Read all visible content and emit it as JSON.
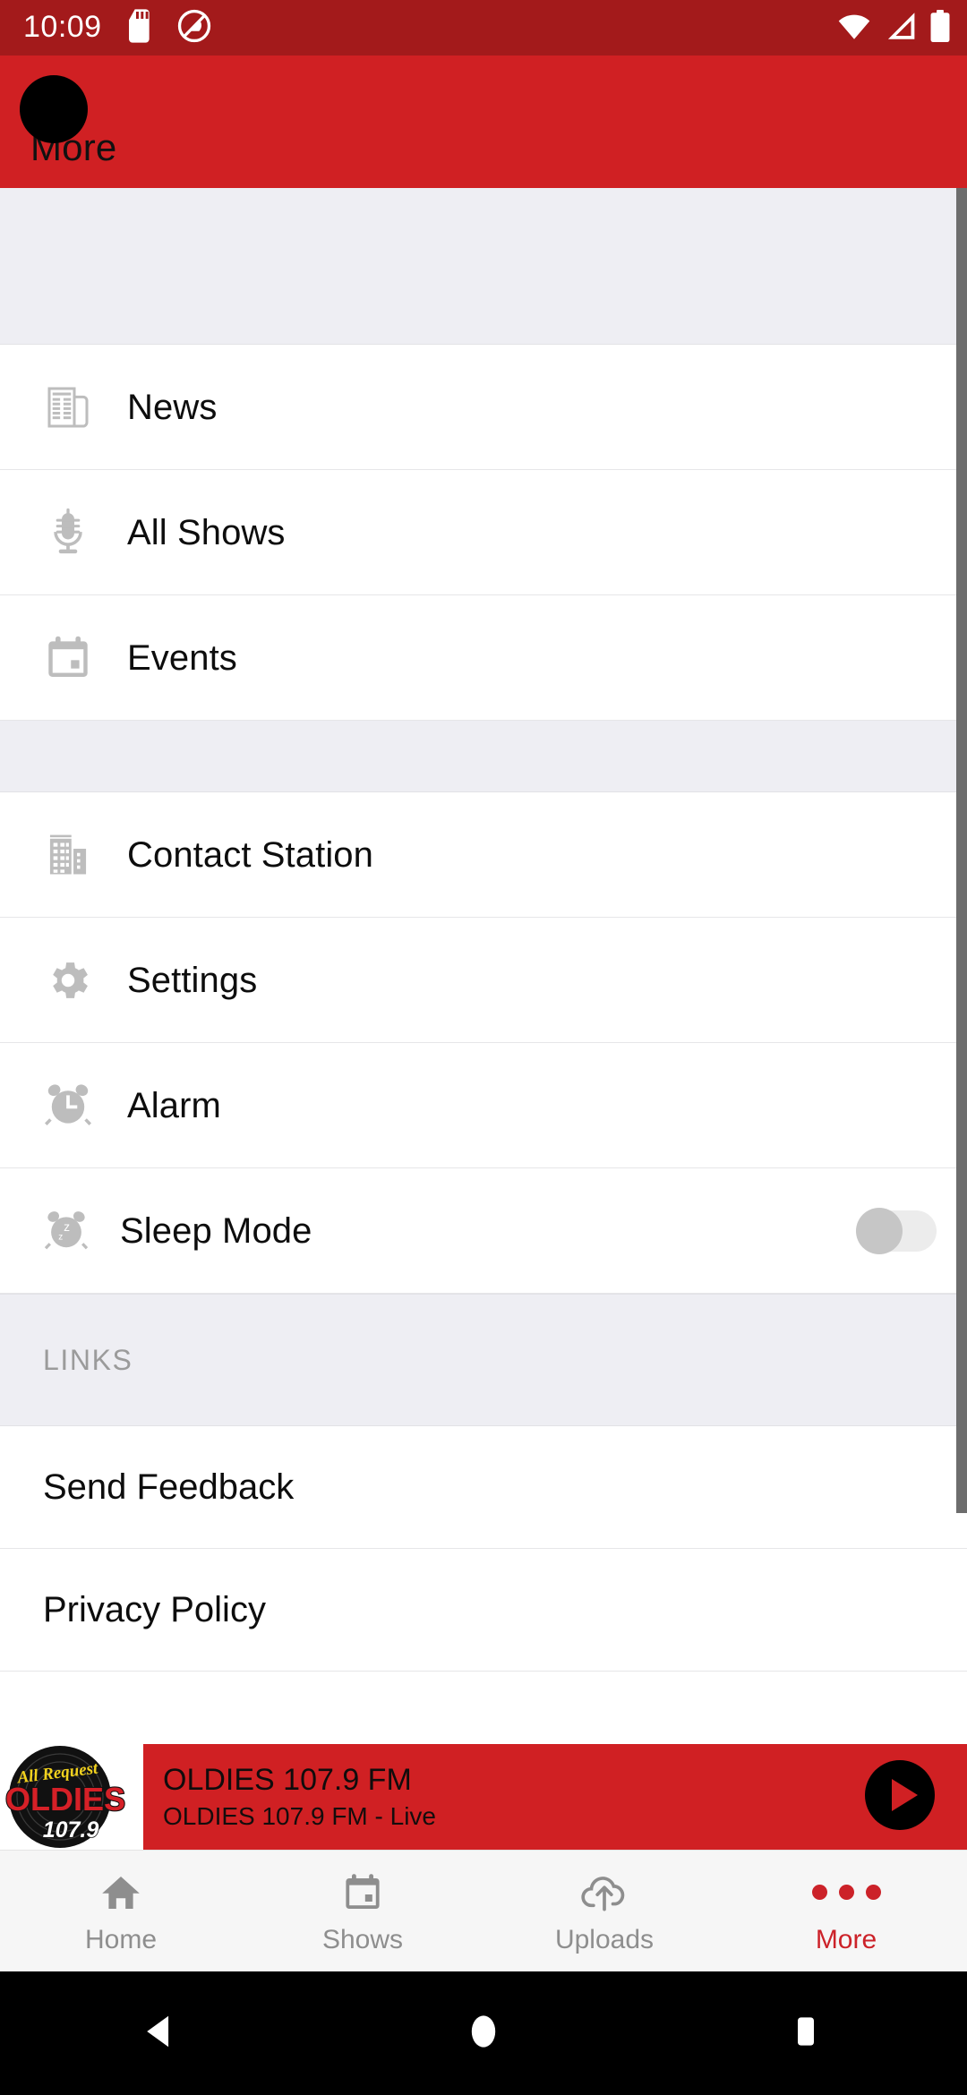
{
  "status_bar": {
    "time": "10:09",
    "left_icons": [
      "sd-card-icon",
      "do-not-disturb-icon"
    ],
    "right_icons": [
      "wifi-icon",
      "cellular-signal-icon",
      "battery-icon"
    ],
    "background_color": "#a31a1b"
  },
  "app_bar": {
    "title": "More",
    "background_color": "#d02023",
    "title_color": "#111111"
  },
  "menu": {
    "group_one": [
      {
        "label": "News",
        "icon": "newspaper-icon"
      },
      {
        "label": "All Shows",
        "icon": "microphone-icon"
      },
      {
        "label": "Events",
        "icon": "calendar-icon"
      }
    ],
    "group_two": [
      {
        "label": "Contact Station",
        "icon": "building-icon"
      },
      {
        "label": "Settings",
        "icon": "gear-icon"
      },
      {
        "label": "Alarm",
        "icon": "alarm-clock-icon"
      }
    ],
    "sleep_mode": {
      "label": "Sleep Mode",
      "icon": "sleep-alarm-icon",
      "toggle_state": "off"
    }
  },
  "links": {
    "header": "LINKS",
    "items": [
      {
        "label": "Send Feedback"
      },
      {
        "label": "Privacy Policy"
      }
    ]
  },
  "now_playing": {
    "title": "OLDIES 107.9 FM",
    "subtitle": "OLDIES 107.9 FM  - Live",
    "play_button_icon": "play-icon",
    "background_color": "#d02023",
    "artwork": {
      "tagline": "All Request",
      "name": "OLDIES",
      "frequency": "107.9"
    }
  },
  "tab_bar": {
    "tabs": [
      {
        "label": "Home",
        "icon": "home-icon",
        "active": false
      },
      {
        "label": "Shows",
        "icon": "calendar-icon",
        "active": false
      },
      {
        "label": "Uploads",
        "icon": "cloud-upload-icon",
        "active": false
      },
      {
        "label": "More",
        "icon": "more-dots-icon",
        "active": true
      }
    ],
    "active_color": "#cc2229",
    "inactive_color": "#8e8e8e"
  },
  "android_nav": {
    "buttons": [
      "back-icon",
      "home-circle-icon",
      "recents-square-icon"
    ]
  }
}
